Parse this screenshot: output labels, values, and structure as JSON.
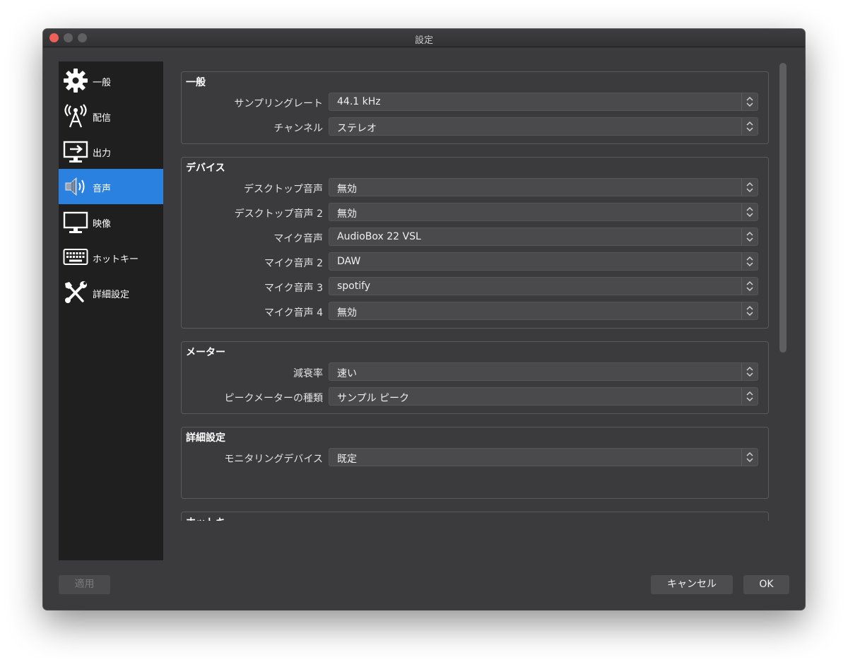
{
  "window": {
    "title": "設定"
  },
  "sidebar": {
    "items": [
      {
        "label": "一般",
        "icon": "gear-icon"
      },
      {
        "label": "配信",
        "icon": "broadcast-antenna-icon"
      },
      {
        "label": "出力",
        "icon": "output-monitor-icon"
      },
      {
        "label": "音声",
        "icon": "speaker-icon",
        "active": true
      },
      {
        "label": "映像",
        "icon": "monitor-icon"
      },
      {
        "label": "ホットキー",
        "icon": "keyboard-icon"
      },
      {
        "label": "詳細設定",
        "icon": "tools-icon"
      }
    ]
  },
  "groups": {
    "general": {
      "title": "一般",
      "rows": [
        {
          "label": "サンプリングレート",
          "value": "44.1 kHz"
        },
        {
          "label": "チャンネル",
          "value": "ステレオ"
        }
      ]
    },
    "devices": {
      "title": "デバイス",
      "rows": [
        {
          "label": "デスクトップ音声",
          "value": "無効"
        },
        {
          "label": "デスクトップ音声 2",
          "value": "無効"
        },
        {
          "label": "マイク音声",
          "value": "AudioBox 22 VSL"
        },
        {
          "label": "マイク音声 2",
          "value": "DAW"
        },
        {
          "label": "マイク音声 3",
          "value": "spotify"
        },
        {
          "label": "マイク音声 4",
          "value": "無効"
        }
      ]
    },
    "meters": {
      "title": "メーター",
      "rows": [
        {
          "label": "減衰率",
          "value": "速い"
        },
        {
          "label": "ピークメーターの種類",
          "value": "サンプル ピーク"
        }
      ]
    },
    "advanced": {
      "title": "詳細設定",
      "rows": [
        {
          "label": "モニタリングデバイス",
          "value": "既定"
        }
      ]
    },
    "hotkeys": {
      "title": "ホットキー"
    }
  },
  "buttons": {
    "apply": "適用",
    "cancel": "キャンセル",
    "ok": "OK"
  },
  "colors": {
    "window_bg": "#3b3a3c",
    "sidebar_bg": "#1f1f1f",
    "accent": "#2a81e0",
    "close_red": "#ed5f57"
  }
}
